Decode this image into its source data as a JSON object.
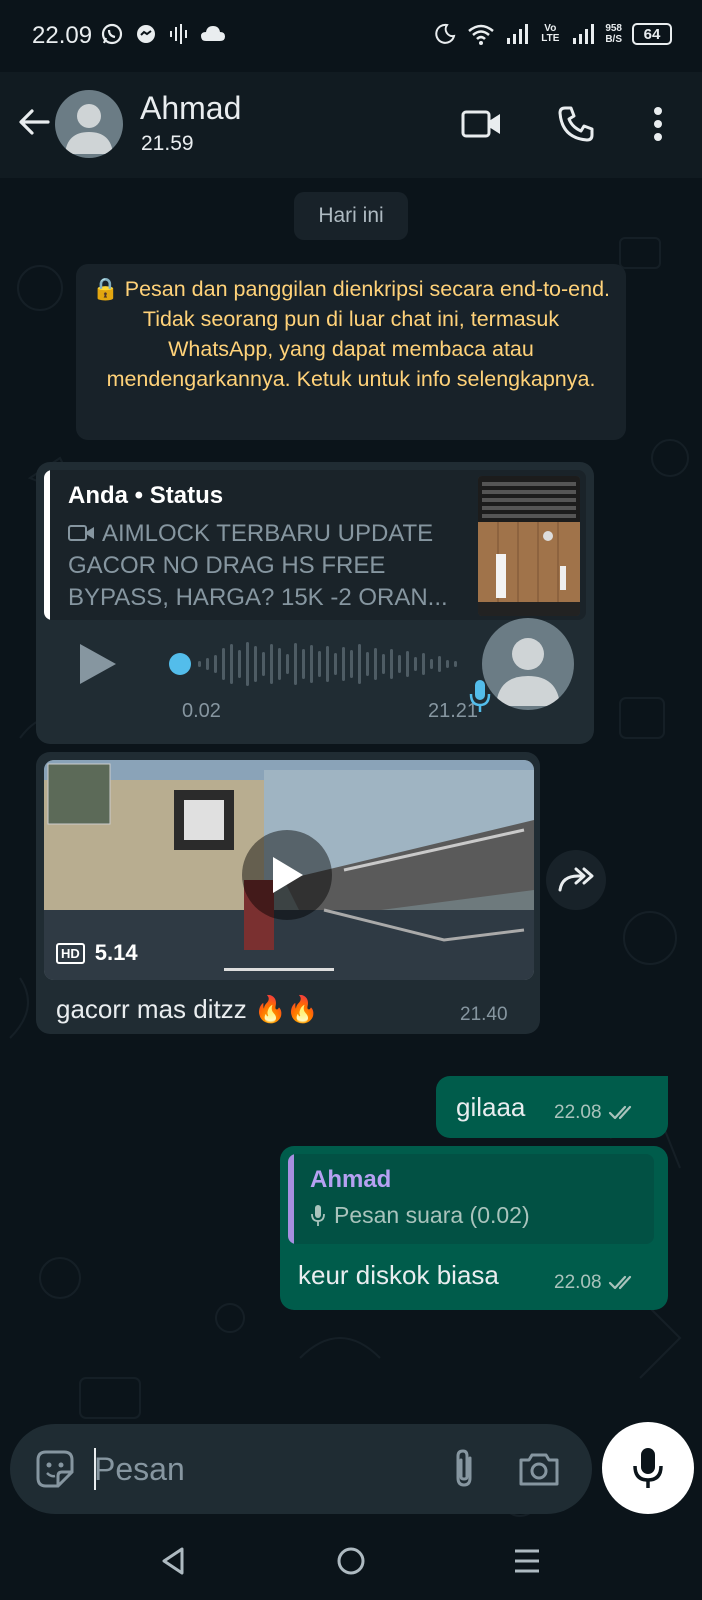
{
  "status_bar": {
    "time": "22.09",
    "net_speed_value": "958",
    "net_speed_unit": "B/S",
    "volte": "Vo LTE",
    "battery": "64",
    "icons": [
      "whatsapp-icon",
      "messenger-icon",
      "audio-icon",
      "cloud-icon",
      "moon-icon",
      "wifi-icon",
      "signal-icon",
      "signal-icon"
    ]
  },
  "header": {
    "contact_name": "Ahmad",
    "last_seen": "21.59",
    "icons": [
      "back-arrow-icon",
      "video-call-icon",
      "phone-icon",
      "more-icon"
    ]
  },
  "chat": {
    "day_label": "Hari ini",
    "encryption_notice": "🔒 Pesan dan panggilan dienkripsi secara end-to-end. Tidak seorang pun di luar chat ini, termasuk WhatsApp, yang dapat membaca atau mendengarkannya. Ketuk untuk info selengkapnya.",
    "messages": [
      {
        "type": "voice",
        "direction": "incoming",
        "quote_title": "Anda • Status",
        "quote_text": "AIMLOCK TERBARU UPDATE GACOR NO DRAG HS FREE BYPASS, HARGA? 15K -2 ORAN...",
        "duration": "0.02",
        "time": "21.21"
      },
      {
        "type": "video",
        "direction": "incoming",
        "badge": "HD",
        "video_length": "5.14",
        "caption": "gacorr mas ditzz 🔥🔥",
        "time": "21.40"
      },
      {
        "type": "text",
        "direction": "outgoing",
        "text": "gilaaa",
        "time": "22.08",
        "status": "read"
      },
      {
        "type": "reply",
        "direction": "outgoing",
        "reply_name": "Ahmad",
        "reply_text": "Pesan suara (0.02)",
        "text": "keur diskok biasa",
        "time": "22.08",
        "status": "read"
      }
    ]
  },
  "input": {
    "placeholder": "Pesan"
  },
  "colors": {
    "background": "#0b141a",
    "header": "#111b21",
    "incoming_bubble": "#202c33",
    "outgoing_bubble": "#005c4b",
    "accent_blue": "#53bdeb",
    "encryption_text": "#ffd279"
  }
}
